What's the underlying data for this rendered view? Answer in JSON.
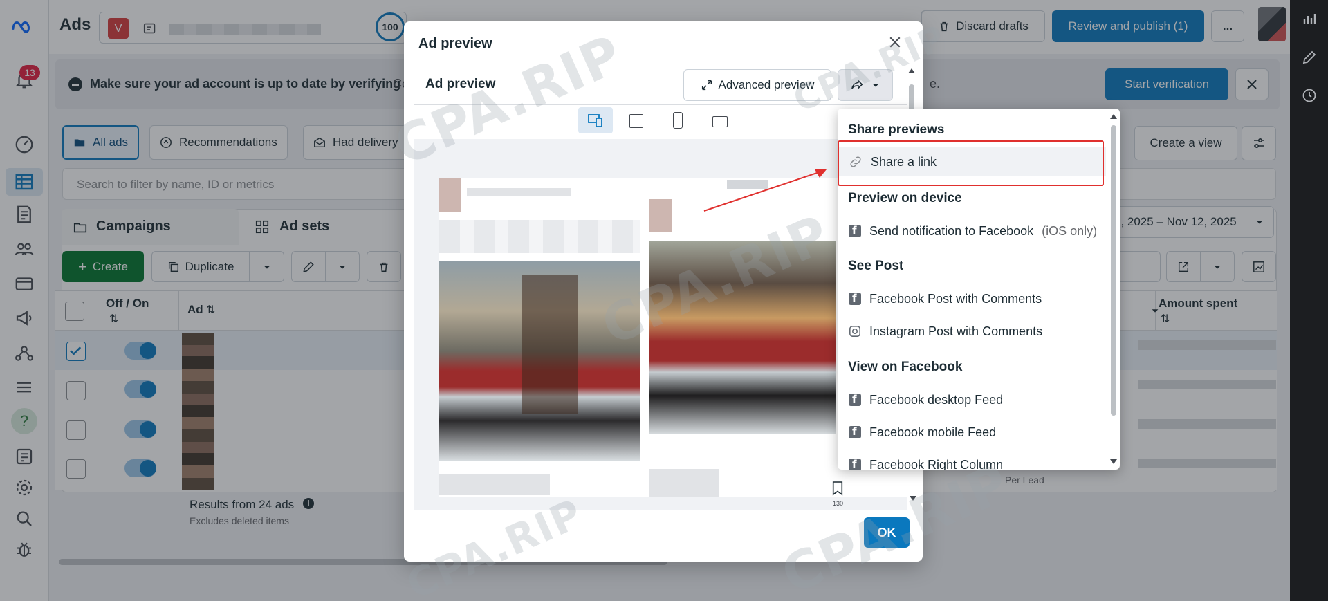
{
  "app": {
    "title": "Ads",
    "account_initial": "V",
    "score": "100",
    "notifications": "13"
  },
  "topbar": {
    "discard_label": "Discard drafts",
    "publish_label": "Review and publish (1)",
    "more_label": "..."
  },
  "banner": {
    "text": "Make sure your ad account is up to date by verifying",
    "text_tail_left": "Co",
    "text_tail_right": "e.",
    "action_label": "Start verification"
  },
  "filters": {
    "all_ads": "All ads",
    "recommendations": "Recommendations",
    "had_delivery": "Had delivery",
    "create_view": "Create a view",
    "search_placeholder": "Search to filter by name, ID or metrics",
    "date_range": "4, 2025 – Nov 12, 2025"
  },
  "levels": {
    "campaigns": "Campaigns",
    "ad_sets": "Ad sets"
  },
  "toolbar": {
    "create_label": "Create",
    "duplicate_label": "Duplicate"
  },
  "table": {
    "col_off_on": "Off / On",
    "col_ad": "Ad",
    "col_amount_spent": "Amount spent",
    "sort_glyph": "⇅",
    "footer_results": "Results from 24 ads",
    "footer_sub": "Excludes deleted items",
    "per_lead": "Per Lead"
  },
  "modal": {
    "title": "Ad preview",
    "subtitle": "Ad preview",
    "advanced_preview_label": "Advanced preview",
    "ok_label": "OK",
    "bookmark_count": "130"
  },
  "dropdown": {
    "share_previews": "Share previews",
    "share_link": "Share a link",
    "preview_on_device": "Preview on device",
    "send_notification": "Send notification to Facebook",
    "ios_only": "(iOS only)",
    "see_post": "See Post",
    "fb_post_comments": "Facebook Post with Comments",
    "ig_post_comments": "Instagram Post with Comments",
    "view_on_facebook": "View on Facebook",
    "fb_desktop_feed": "Facebook desktop Feed",
    "fb_mobile_feed": "Facebook mobile Feed",
    "fb_right_column": "Facebook Right Column"
  },
  "watermark": {
    "text": "CPA.RIP"
  },
  "colors": {
    "primary_blue": "#0a78be",
    "create_green": "#00742b",
    "highlight_red": "#e0302e"
  }
}
